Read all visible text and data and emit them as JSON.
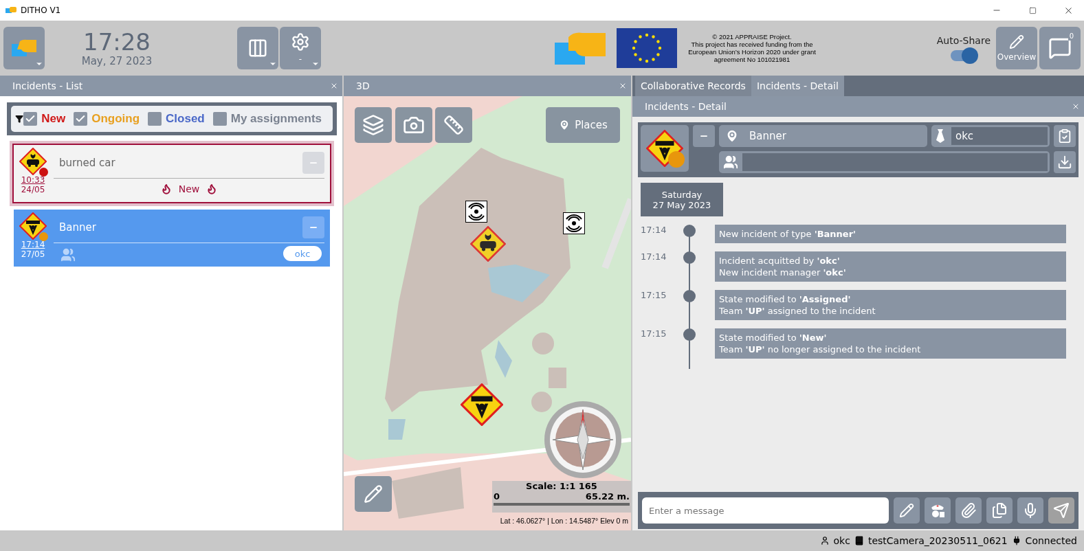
{
  "window": {
    "title": "DITHO V1"
  },
  "toolbar": {
    "time": "17:28",
    "date": "May, 27 2023",
    "settings_label": "-",
    "funding_lines": [
      "© 2021 APPRAISE Project.",
      "This project has received funding from the",
      "European Union’s Horizon 2020 under grant",
      "agreement No 101021981"
    ],
    "auto_share": {
      "label": "Auto-Share",
      "on": true
    },
    "overview_label": "Overview",
    "chat_count": "0"
  },
  "incidents_list": {
    "title": "Incidents - List",
    "filters": [
      {
        "label": "New",
        "checked": true,
        "color": "#d01818"
      },
      {
        "label": "Ongoing",
        "checked": true,
        "color": "#e8a020"
      },
      {
        "label": "Closed",
        "checked": false,
        "color": "#4a68c8"
      },
      {
        "label": "My assignments",
        "checked": false,
        "color": "#7a8290"
      }
    ],
    "incidents": [
      {
        "kind": "new",
        "title": "burned car",
        "time": "10:33",
        "date": "24/05",
        "color": "#cc1111",
        "selected": false,
        "status": "New"
      },
      {
        "kind": "assigned",
        "title": "Banner",
        "time": "17:14",
        "date": "27/05",
        "color": "#e8960c",
        "selected": true,
        "assignee": "okc"
      }
    ]
  },
  "map": {
    "title": "3D",
    "places_label": "Places",
    "scale": "Scale: 1:1 165",
    "scale_start": "0",
    "scale_end": "65.22 m.",
    "coordinates": "Lat : 46.0627° | Lon : 14.5487° Elev 0 m"
  },
  "detail": {
    "tabs": [
      {
        "label": "Collaborative Records",
        "selected": false
      },
      {
        "label": "Incidents - Detail",
        "selected": true
      }
    ],
    "title": "Incidents - Detail",
    "name": "Banner",
    "manager": "okc",
    "status": {
      "color": "#e8960c"
    },
    "day": "Saturday",
    "date": "27 May 2023",
    "events": [
      {
        "time": "17:14",
        "lines": [
          "New incident of type **'Banner'**"
        ]
      },
      {
        "time": "17:14",
        "lines": [
          "Incident acquitted by **'okc'**",
          "New incident manager **'okc'**"
        ]
      },
      {
        "time": "17:15",
        "lines": [
          "State modified to **'Assigned'**",
          "Team **'UP'** assigned to the incident"
        ]
      },
      {
        "time": "17:15",
        "lines": [
          "State modified to **'New'**",
          "Team **'UP'** no longer assigned to the incident"
        ]
      }
    ],
    "message_placeholder": "Enter a message"
  },
  "status_bar": {
    "user": "okc",
    "session": "testCamera_20230511_0621",
    "connection": "Connected"
  }
}
